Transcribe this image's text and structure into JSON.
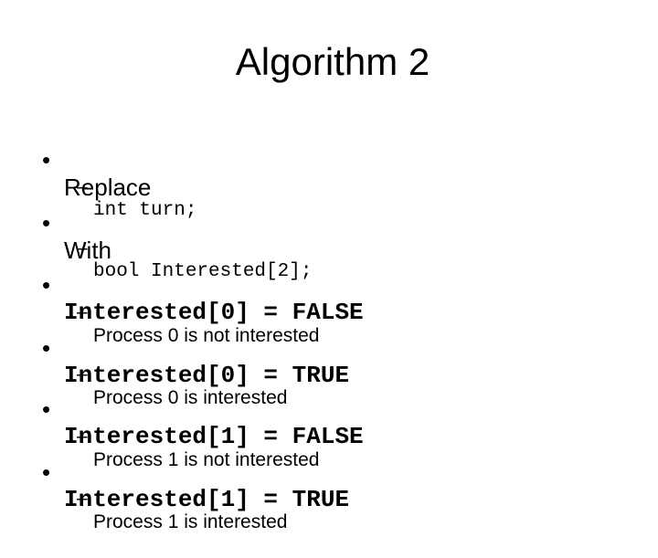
{
  "slide": {
    "title": "Algorithm 2",
    "bullets": [
      {
        "text": "Replace",
        "sub": "int turn;"
      },
      {
        "text": "With",
        "sub": "bool Interested[2];"
      },
      {
        "text": "Interested[0] = FALSE",
        "sub": "Process 0 is not interested"
      },
      {
        "text": "Interested[0] = TRUE",
        "sub": "Process 0 is interested"
      },
      {
        "text": "Interested[1] = FALSE",
        "sub": "Process 1 is not interested"
      },
      {
        "text": "Interested[1] = TRUE",
        "sub": "Process 1 is interested"
      }
    ],
    "bullet_glyph": "•",
    "dash_glyph": "–"
  }
}
